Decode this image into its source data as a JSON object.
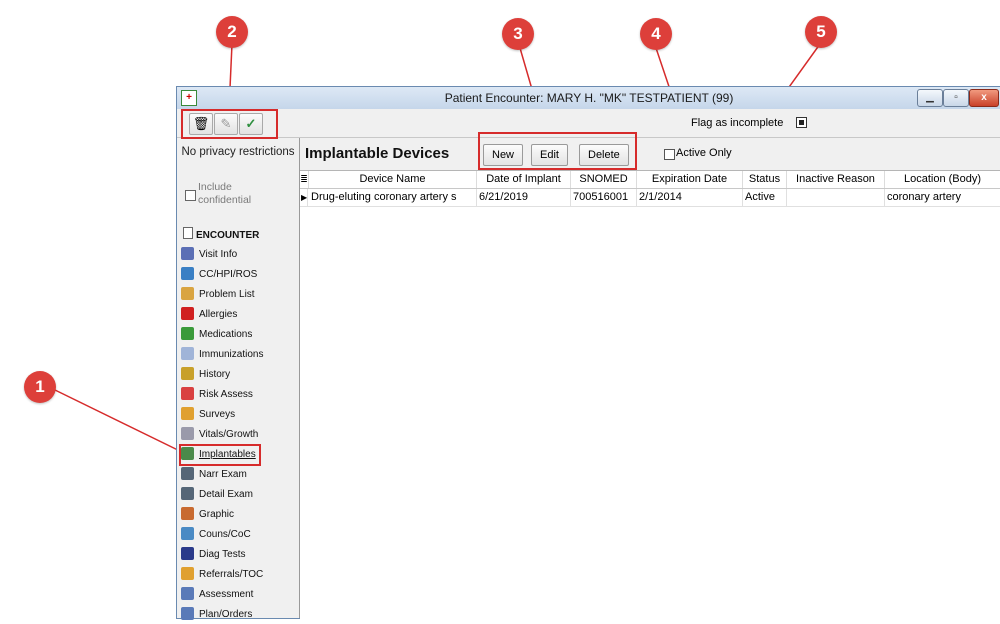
{
  "window": {
    "title": "Patient Encounter: MARY H. \"MK\" TESTPATIENT (99)",
    "controls": [
      "minimize",
      "maximize",
      "close"
    ],
    "close_glyph": "x"
  },
  "toolbar": {
    "buttons": [
      {
        "icon": "trash-icon",
        "glyph": "🗑"
      },
      {
        "icon": "pencil-icon",
        "glyph": "✎"
      },
      {
        "icon": "check-icon",
        "glyph": "✓"
      }
    ],
    "flag_label": "Flag as incomplete"
  },
  "sidebar": {
    "privacy_text": "No privacy restrictions",
    "include_label": "Include confidential",
    "section_header": "ENCOUNTER",
    "items": [
      {
        "label": "Visit Info",
        "color": "#5b6fb5"
      },
      {
        "label": "CC/HPI/ROS",
        "color": "#3a7fc4"
      },
      {
        "label": "Problem List",
        "color": "#d9a441"
      },
      {
        "label": "Allergies",
        "color": "#d02020"
      },
      {
        "label": "Medications",
        "color": "#3a9a3a"
      },
      {
        "label": "Immunizations",
        "color": "#a0b4d8"
      },
      {
        "label": "History",
        "color": "#c8a02a"
      },
      {
        "label": "Risk Assess",
        "color": "#d94040"
      },
      {
        "label": "Surveys",
        "color": "#e0a030"
      },
      {
        "label": "Vitals/Growth",
        "color": "#9a9aaa"
      },
      {
        "label": "Implantables",
        "color": "#4a8a4a",
        "selected": true
      },
      {
        "label": "Narr Exam",
        "color": "#556677"
      },
      {
        "label": "Detail Exam",
        "color": "#556677"
      },
      {
        "label": "Graphic",
        "color": "#c86a30"
      },
      {
        "label": "Couns/CoC",
        "color": "#4a8ac4"
      },
      {
        "label": "Diag Tests",
        "color": "#2a3a8a"
      },
      {
        "label": "Referrals/TOC",
        "color": "#e0a030"
      },
      {
        "label": "Assessment",
        "color": "#5a7ab8"
      },
      {
        "label": "Plan/Orders",
        "color": "#5a7ab8"
      }
    ]
  },
  "main": {
    "title": "Implantable Devices",
    "buttons": {
      "new": "New",
      "edit": "Edit",
      "delete": "Delete"
    },
    "active_only_label": "Active Only",
    "grid": {
      "columns": [
        "Device Name",
        "Date of Implant",
        "SNOMED",
        "Expiration Date",
        "Status",
        "Inactive Reason",
        "Location (Body)"
      ],
      "rows": [
        [
          "Drug-eluting coronary artery s",
          "6/21/2019",
          "700516001",
          "2/1/2014",
          "Active",
          "",
          "coronary artery"
        ]
      ]
    }
  },
  "callouts": [
    "1",
    "2",
    "3",
    "4",
    "5"
  ],
  "colors": {
    "callout": "#dd3f3a",
    "highlight": "#d62b2b"
  }
}
